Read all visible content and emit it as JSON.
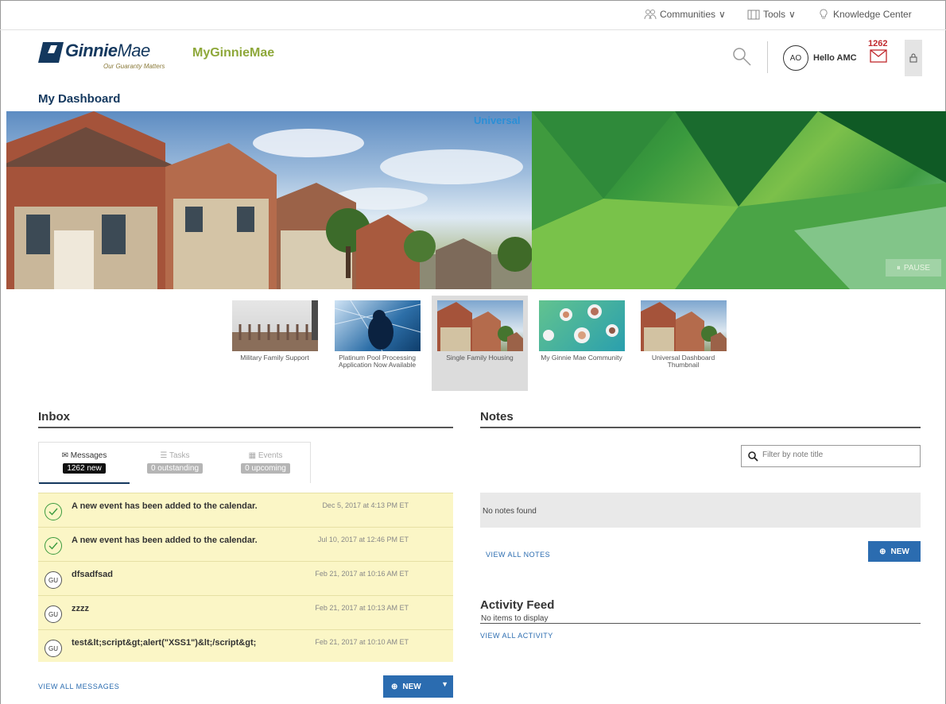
{
  "utility": {
    "communities": "Communities",
    "tools": "Tools",
    "knowledge": "Knowledge Center"
  },
  "brand": {
    "logo_name_bold": "Ginnie",
    "logo_name_light": "Mae",
    "logo_tagline": "Our Guaranty Matters",
    "product": "MyGinnieMae",
    "colors": {
      "navy": "#14385e",
      "olive": "#8ea83a",
      "link_blue": "#2b6cb0",
      "alert_red": "#c0282d"
    }
  },
  "user": {
    "initials": "AO",
    "greeting": "Hello AMC",
    "mail_count": "1262"
  },
  "page": {
    "title": "My Dashboard"
  },
  "hero": {
    "label": "Universal",
    "pause_label": "PAUSE"
  },
  "thumbnails": [
    {
      "caption": "Military Family Support"
    },
    {
      "caption": "Platinum Pool Processing Application Now Available"
    },
    {
      "caption": "Single Family Housing",
      "active": true
    },
    {
      "caption": "My Ginnie Mae Community"
    },
    {
      "caption": "Universal Dashboard Thumbnail"
    }
  ],
  "inbox": {
    "title": "Inbox",
    "tabs": [
      {
        "label": "Messages",
        "badge": "1262 new",
        "icon": "envelope-icon"
      },
      {
        "label": "Tasks",
        "badge": "0 outstanding",
        "icon": "list-icon"
      },
      {
        "label": "Events",
        "badge": "0 upcoming",
        "icon": "calendar-icon"
      }
    ],
    "messages": [
      {
        "icon": "check",
        "text": "A new event has been added to the calendar.",
        "date": "Dec 5, 2017 at 4:13 PM ET"
      },
      {
        "icon": "check",
        "text": "A new event has been added to the calendar.",
        "date": "Jul 10, 2017 at 12:46 PM ET"
      },
      {
        "icon": "GU",
        "text": "dfsadfsad",
        "date": "Feb 21, 2017 at 10:16 AM ET"
      },
      {
        "icon": "GU",
        "text": "zzzz",
        "date": "Feb 21, 2017 at 10:13 AM ET"
      },
      {
        "icon": "GU",
        "text": "test&lt;script&gt;alert(\"XSS1\")&lt;/script&gt;",
        "date": "Feb 21, 2017 at 10:10 AM ET"
      }
    ],
    "view_all": "VIEW ALL MESSAGES",
    "new_label": "NEW"
  },
  "notes": {
    "title": "Notes",
    "filter_placeholder": "Filter by note title",
    "empty": "No notes found",
    "view_all": "VIEW ALL NOTES",
    "new_label": "NEW"
  },
  "activity": {
    "title": "Activity Feed",
    "empty": "No items to display",
    "view_all": "VIEW ALL ACTIVITY"
  }
}
